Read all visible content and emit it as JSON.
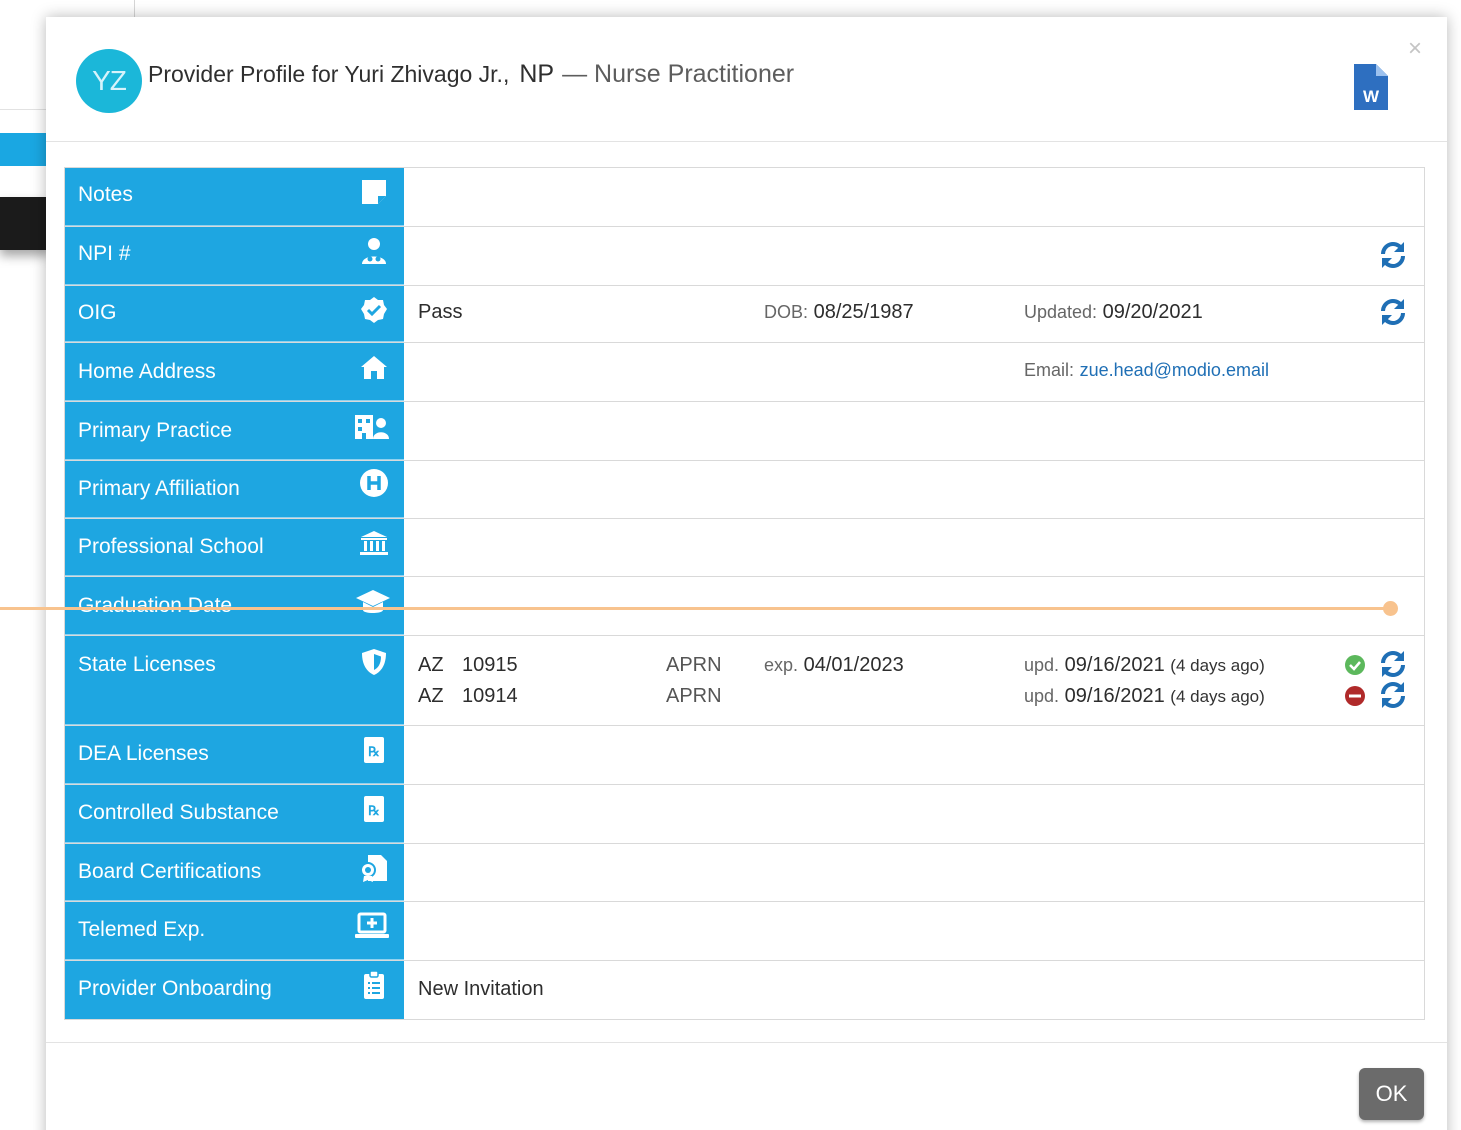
{
  "modal": {
    "avatar_initials": "YZ",
    "title_prefix": "Provider Profile for Yuri Zhivago Jr.,",
    "credential": "NP",
    "specialty": "— Nurse Practitioner",
    "close_label": "×",
    "export_icon": "word-document-icon",
    "ok_label": "OK"
  },
  "colors": {
    "label_bg": "#1ea6e1",
    "accent_blue": "#1f6fb5",
    "success": "#5cb85c",
    "danger": "#b02a2a",
    "ok_button": "#6b6b6b"
  },
  "rows": {
    "notes": {
      "label": "Notes",
      "icon": "sticky-note-icon"
    },
    "npi": {
      "label": "NPI #",
      "icon": "user-doctor-icon"
    },
    "oig": {
      "label": "OIG",
      "icon": "badge-check-icon",
      "status": "Pass",
      "dob_label": "DOB:",
      "dob": "08/25/1987",
      "updated_label": "Updated:",
      "updated": "09/20/2021"
    },
    "home_address": {
      "label": "Home Address",
      "icon": "home-icon",
      "email_label": "Email:",
      "email": "zue.head@modio.email"
    },
    "primary_practice": {
      "label": "Primary Practice",
      "icon": "clinic-user-icon"
    },
    "primary_affiliation": {
      "label": "Primary Affiliation",
      "icon": "hospital-h-icon"
    },
    "professional_school": {
      "label": "Professional School",
      "icon": "university-icon"
    },
    "graduation_date": {
      "label": "Graduation Date",
      "icon": "graduation-cap-icon"
    },
    "state_licenses": {
      "label": "State Licenses",
      "icon": "shield-icon",
      "items": [
        {
          "state": "AZ",
          "number": "10915",
          "type": "APRN",
          "exp_label": "exp.",
          "exp": "04/01/2023",
          "upd_label": "upd.",
          "upd": "09/16/2021",
          "ago": "(4 days ago)",
          "status": "active"
        },
        {
          "state": "AZ",
          "number": "10914",
          "type": "APRN",
          "exp_label": "",
          "exp": "",
          "upd_label": "upd.",
          "upd": "09/16/2021",
          "ago": "(4 days ago)",
          "status": "inactive"
        }
      ]
    },
    "dea_licenses": {
      "label": "DEA Licenses",
      "icon": "prescription-icon"
    },
    "controlled_substance": {
      "label": "Controlled Substance",
      "icon": "prescription-icon"
    },
    "board_certifications": {
      "label": "Board Certifications",
      "icon": "certificate-icon"
    },
    "telemed": {
      "label": "Telemed Exp.",
      "icon": "laptop-medical-icon"
    },
    "onboarding": {
      "label": "Provider Onboarding",
      "icon": "clipboard-list-icon",
      "value": "New Invitation"
    }
  }
}
